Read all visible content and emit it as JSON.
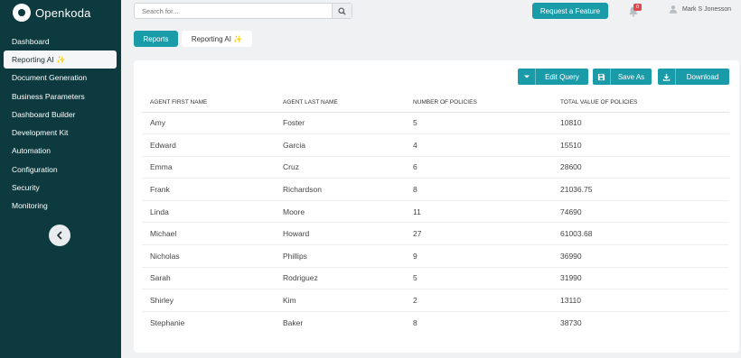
{
  "app": {
    "name": "Openkoda"
  },
  "sidebar": {
    "items": [
      {
        "label": "Dashboard"
      },
      {
        "label": "Reporting AI ✨"
      },
      {
        "label": "Document Generation"
      },
      {
        "label": "Business Parameters"
      },
      {
        "label": "Dashboard Builder"
      },
      {
        "label": "Development Kit"
      },
      {
        "label": "Automation"
      },
      {
        "label": "Configuration"
      },
      {
        "label": "Security"
      },
      {
        "label": "Monitoring"
      }
    ],
    "active_index": 1
  },
  "header": {
    "search_placeholder": "Search for...",
    "request_feature_label": "Request a Feature",
    "notification_count": "0",
    "user_name": "Mark S Jonesson"
  },
  "tabs": {
    "reports": "Reports",
    "reporting_ai": "Reporting AI ✨"
  },
  "toolbar": {
    "edit_query": "Edit Query",
    "save_as": "Save As",
    "download": "Download"
  },
  "table": {
    "headers": [
      "AGENT FIRST NAME",
      "AGENT LAST NAME",
      "NUMBER OF POLICIES",
      "TOTAL VALUE OF POLICIES"
    ],
    "rows": [
      [
        "Amy",
        "Foster",
        "5",
        "10810"
      ],
      [
        "Edward",
        "Garcia",
        "4",
        "15510"
      ],
      [
        "Emma",
        "Cruz",
        "6",
        "28600"
      ],
      [
        "Frank",
        "Richardson",
        "8",
        "21036.75"
      ],
      [
        "Linda",
        "Moore",
        "11",
        "74690"
      ],
      [
        "Michael",
        "Howard",
        "27",
        "61003.68"
      ],
      [
        "Nicholas",
        "Phillips",
        "9",
        "36990"
      ],
      [
        "Sarah",
        "Rodriguez",
        "5",
        "31990"
      ],
      [
        "Shirley",
        "Kim",
        "2",
        "13110"
      ],
      [
        "Stephanie",
        "Baker",
        "8",
        "38730"
      ]
    ]
  }
}
